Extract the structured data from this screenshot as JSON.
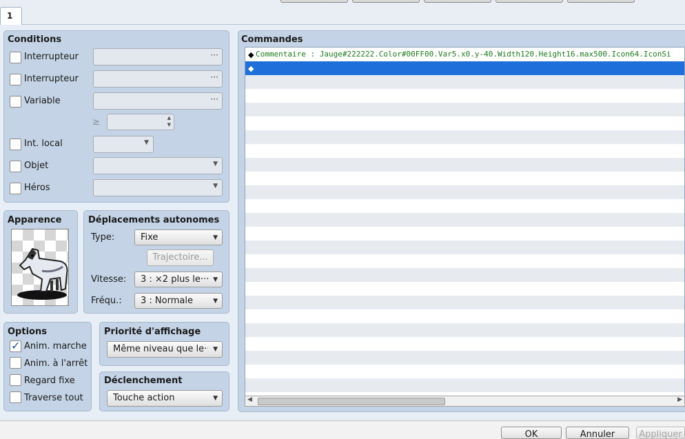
{
  "tabs": {
    "page_tab": "1"
  },
  "conditions": {
    "title": "Conditions",
    "rows": [
      {
        "label": "Interrupteur",
        "checked": false
      },
      {
        "label": "Interrupteur",
        "checked": false
      },
      {
        "label": "Variable",
        "checked": false
      },
      {
        "label": "Int. local",
        "checked": false
      },
      {
        "label": "Objet",
        "checked": false
      },
      {
        "label": "Héros",
        "checked": false
      }
    ],
    "browse_glyph": "···",
    "compare_symbol": "≥"
  },
  "apparence": {
    "title": "Apparence"
  },
  "deplacements": {
    "title": "Déplacements autonomes",
    "type_label": "Type:",
    "type_value": "Fixe",
    "trajectoire_label": "Trajectoire...",
    "vitesse_label": "Vitesse:",
    "vitesse_value": "3 : ×2 plus le···",
    "frequence_label": "Fréqu.:",
    "frequence_value": "3 : Normale"
  },
  "options": {
    "title": "Options",
    "items": [
      {
        "label": "Anim. marche",
        "checked": true
      },
      {
        "label": "Anim. à l'arrêt",
        "checked": false
      },
      {
        "label": "Regard fixe",
        "checked": false
      },
      {
        "label": "Traverse tout",
        "checked": false
      }
    ]
  },
  "priorite": {
    "title": "Priorité d'affichage",
    "value": "Même niveau que le···"
  },
  "declenchement": {
    "title": "Déclenchement",
    "value": "Touche action"
  },
  "commandes": {
    "title": "Commandes",
    "lines": [
      {
        "text": "Commentaire : Jauge#222222.Color#00FF00.Var5.x0.y-40.Width120.Height16.max500.Icon64.IconSi",
        "selected": false
      },
      {
        "text": "",
        "selected": true
      }
    ]
  },
  "buttons": {
    "ok": "OK",
    "annuler": "Annuler",
    "appliquer": "Appliquer"
  },
  "colors": {
    "selection": "#1e6fd9",
    "panel": "#c4d3e5",
    "comment_text": "#1a7a1a"
  }
}
